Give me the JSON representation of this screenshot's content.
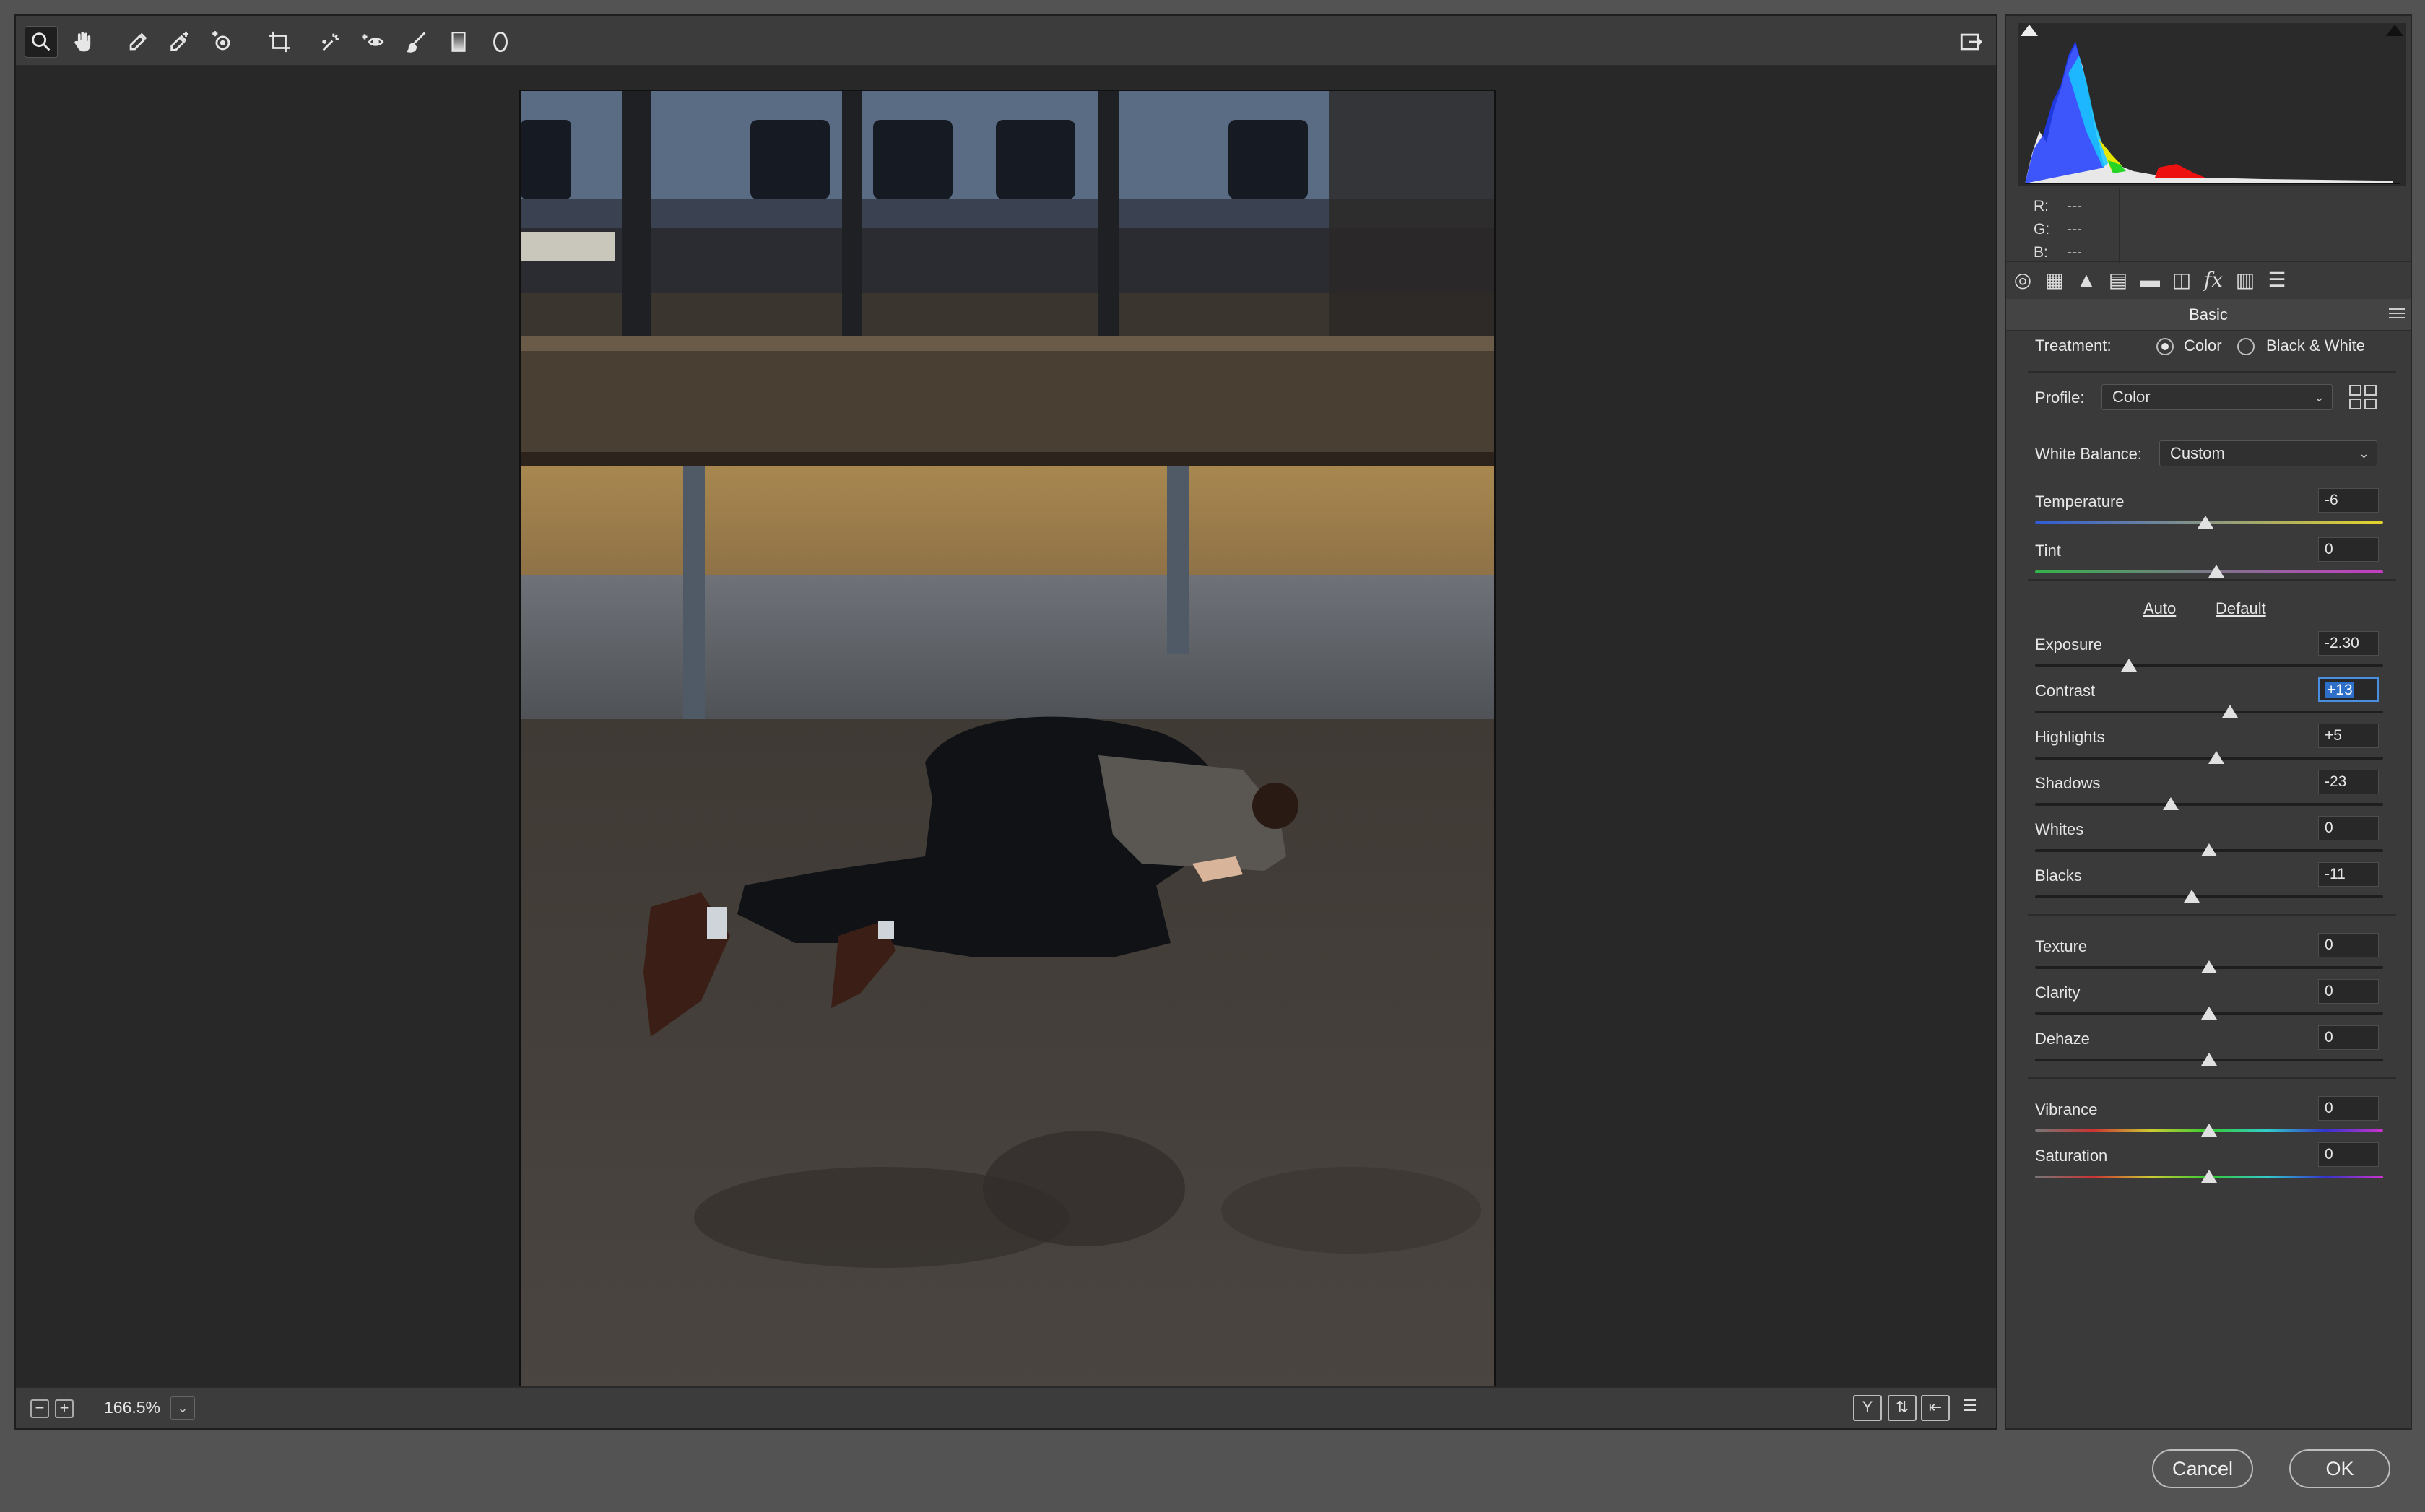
{
  "toolbar": {
    "tools": [
      "zoom-tool",
      "hand-tool",
      "white-balance-tool",
      "color-sampler-tool",
      "targeted-adjustment-tool",
      "crop-tool",
      "spot-removal-tool",
      "red-eye-tool",
      "adjustment-brush-tool",
      "graduated-filter-tool",
      "radial-filter-tool"
    ],
    "active_tool": "zoom-tool"
  },
  "statusbar": {
    "zoom": "166.5%"
  },
  "panel": {
    "rgb": {
      "r_label": "R:",
      "r_value": "---",
      "g_label": "G:",
      "g_value": "---",
      "b_label": "B:",
      "b_value": "---"
    },
    "section_title": "Basic",
    "treatment": {
      "label": "Treatment:",
      "color": "Color",
      "bw": "Black & White",
      "selected": "Color"
    },
    "profile": {
      "label": "Profile:",
      "value": "Color"
    },
    "white_balance": {
      "label": "White Balance:",
      "value": "Custom"
    },
    "auto": "Auto",
    "default": "Default",
    "sliders": {
      "temperature": {
        "label": "Temperature",
        "value": "-6"
      },
      "tint": {
        "label": "Tint",
        "value": "0"
      },
      "exposure": {
        "label": "Exposure",
        "value": "-2.30"
      },
      "contrast": {
        "label": "Contrast",
        "value": "+13"
      },
      "highlights": {
        "label": "Highlights",
        "value": "+5"
      },
      "shadows": {
        "label": "Shadows",
        "value": "-23"
      },
      "whites": {
        "label": "Whites",
        "value": "0"
      },
      "blacks": {
        "label": "Blacks",
        "value": "-11"
      },
      "texture": {
        "label": "Texture",
        "value": "0"
      },
      "clarity": {
        "label": "Clarity",
        "value": "0"
      },
      "dehaze": {
        "label": "Dehaze",
        "value": "0"
      },
      "vibrance": {
        "label": "Vibrance",
        "value": "0"
      },
      "saturation": {
        "label": "Saturation",
        "value": "0"
      }
    }
  },
  "buttons": {
    "cancel": "Cancel",
    "ok": "OK"
  }
}
